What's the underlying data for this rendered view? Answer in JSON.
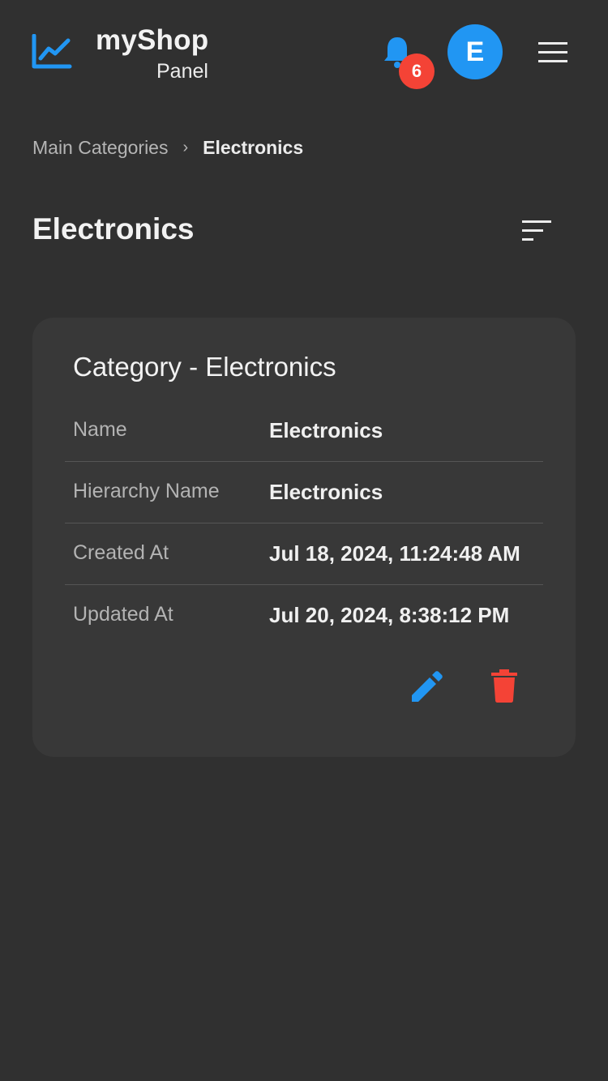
{
  "header": {
    "brand_title": "myShop",
    "brand_subtitle": "Panel",
    "notification_count": "6",
    "avatar_letter": "E"
  },
  "breadcrumb": {
    "parent": "Main Categories",
    "separator": "›",
    "current": "Electronics"
  },
  "page": {
    "title": "Electronics"
  },
  "card": {
    "title": "Category - Electronics",
    "rows": [
      {
        "label": "Name",
        "value": "Electronics"
      },
      {
        "label": "Hierarchy Name",
        "value": "Electronics"
      },
      {
        "label": "Created At",
        "value": "Jul 18, 2024, 11:24:48 AM"
      },
      {
        "label": "Updated At",
        "value": "Jul 20, 2024, 8:38:12 PM"
      }
    ]
  },
  "icons": {
    "logo": "chart-line-icon",
    "notifications": "bell-icon",
    "menu": "hamburger-menu-icon",
    "sort": "sort-icon",
    "edit": "pencil-icon",
    "delete": "trash-icon"
  },
  "colors": {
    "background": "#303030",
    "card": "#383838",
    "accent": "#2196f3",
    "danger": "#f44336"
  }
}
